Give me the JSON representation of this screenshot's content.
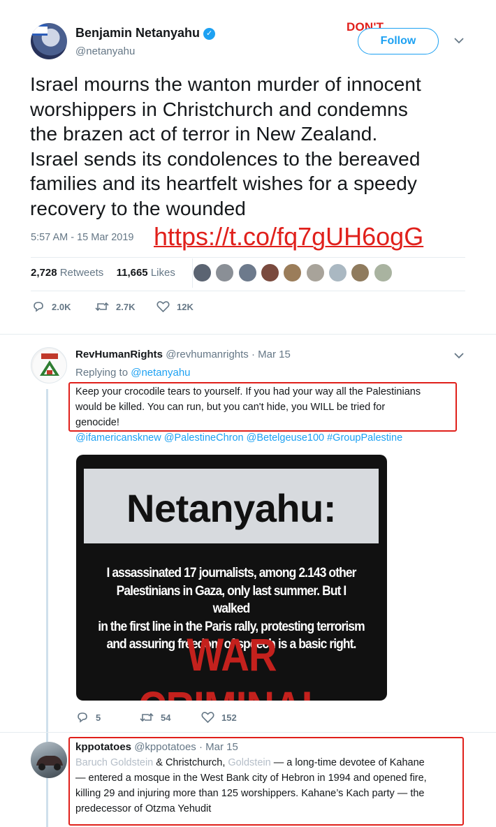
{
  "main_tweet": {
    "display_name": "Benjamin Netanyahu",
    "handle": "@netanyahu",
    "annotation": "DON'T",
    "follow_label": "Follow",
    "lines": [
      "Israel mourns the wanton murder of innocent",
      "worshippers in Christchurch and condemns",
      "the brazen act of terror in New Zealand.",
      "Israel sends its condolences to the bereaved",
      "families and its heartfelt wishes for a speedy",
      "recovery to the wounded"
    ],
    "timestamp": "5:57 AM - 15 Mar 2019",
    "link": "https://t.co/fq7gUH6ogG",
    "retweets_count": "2,728",
    "retweets_label": "Retweets",
    "likes_count": "11,665",
    "likes_label": "Likes",
    "actions": {
      "replies": "2.0K",
      "retweets": "2.7K",
      "likes": "12K"
    }
  },
  "replies": [
    {
      "display_name": "RevHumanRights",
      "handle": "@revhumanrights",
      "date": "· Mar 15",
      "replying_prefix": "Replying to",
      "replying_to": "@netanyahu",
      "lines": [
        "Keep your crocodile tears to yourself.  If you had your way all the Palestinians",
        "would be killed.  You can run, but you can't hide, you WILL be tried for",
        "genocide!"
      ],
      "mentions": "@ifamericansknew @PalestineChron @Betelgeuse100 #GroupPalestine",
      "image": {
        "headline": "Netanyahu:",
        "quote_lines": [
          "I assassinated 17 journalists, among 2.143 other",
          "Palestinians in Gaza, only last summer. But I walked",
          "in the first line in the Paris rally, protesting terrorism",
          "and assuring freedom of speech is a basic right."
        ],
        "verdict": "WAR CRIMINAL"
      },
      "actions": {
        "replies": "5",
        "retweets": "54",
        "likes": "152"
      }
    },
    {
      "display_name": "kppotatoes",
      "handle": "@kppotatoes",
      "date": "· Mar 15",
      "line1": {
        "blurred_a": "Baruch Goldstein",
        "text_a": " & Christchurch, ",
        "blurred_b": "Goldstein",
        "text_b": " — a long-time devotee of Kahane"
      },
      "lines": [
        "— entered a mosque in the West Bank city of Hebron in 1994 and opened fire,",
        "killing 29 and injuring more than 125 worshippers. Kahane’s Kach party — the",
        "predecessor of Otzma Yehudit"
      ]
    }
  ],
  "colors": {
    "accent": "#1da1f2",
    "annotation_red": "#e0201b",
    "muted": "#657786"
  },
  "icons": [
    "verified-badge-icon",
    "chevron-down-icon",
    "reply-icon",
    "retweet-icon",
    "like-icon"
  ]
}
